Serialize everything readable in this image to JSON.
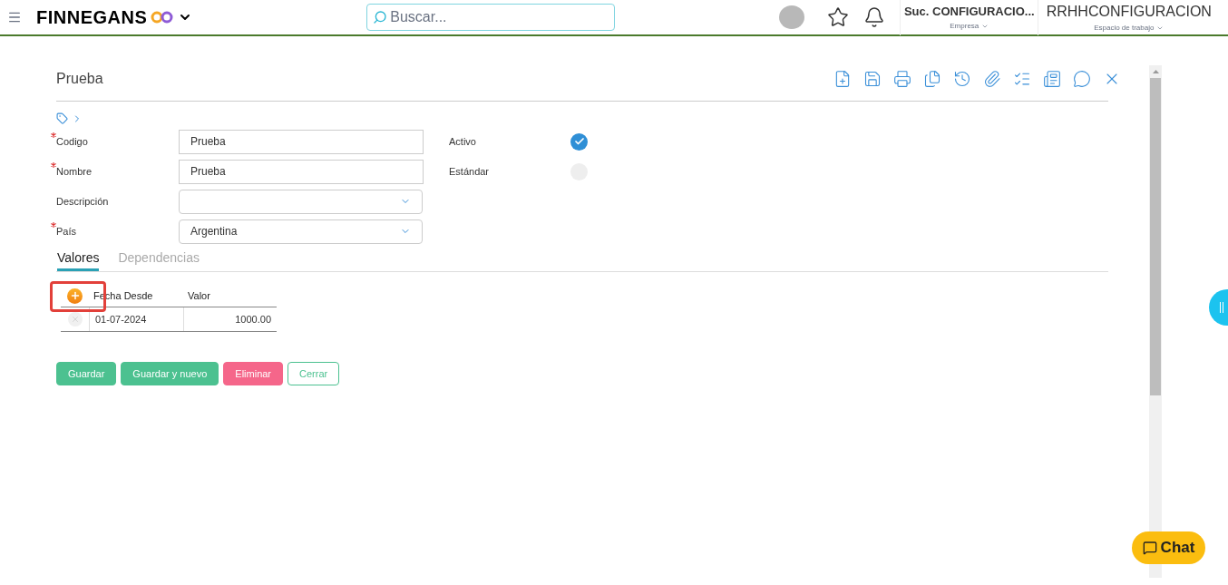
{
  "header": {
    "brand": "FINNEGANS",
    "search": {
      "placeholder": "Buscar..."
    },
    "company": {
      "value": "Suc. CONFIGURACIO...",
      "label": "Empresa"
    },
    "workspace": {
      "value": "RRHHCONFIGURACION",
      "label": "Espacio de trabajo"
    }
  },
  "form": {
    "title": "Prueba",
    "fields": [
      {
        "label": "Codigo",
        "required": true,
        "kind": "text",
        "value": "Prueba"
      },
      {
        "label": "Nombre",
        "required": true,
        "kind": "text",
        "value": "Prueba"
      },
      {
        "label": "Descripción",
        "required": false,
        "kind": "select"
      },
      {
        "label": "País",
        "required": true,
        "kind": "select",
        "value": "Argentina"
      }
    ],
    "checks": [
      {
        "label": "Activo",
        "checked": true
      },
      {
        "label": "Estándar",
        "checked": false
      }
    ],
    "tabs": [
      {
        "label": "Valores",
        "selected": true
      },
      {
        "label": "Dependencias",
        "selected": false
      }
    ],
    "table": {
      "columns": [
        "Fecha Desde",
        "Valor"
      ],
      "rows": [
        [
          "01-07-2024",
          "1000.00"
        ]
      ]
    },
    "buttons": [
      {
        "label": "Guardar",
        "kind": "primary"
      },
      {
        "label": "Guardar y nuevo",
        "kind": "primary"
      },
      {
        "label": "Eliminar",
        "kind": "danger"
      },
      {
        "label": "Cerrar",
        "kind": "outline"
      }
    ]
  },
  "chat": {
    "label": "Chat"
  }
}
